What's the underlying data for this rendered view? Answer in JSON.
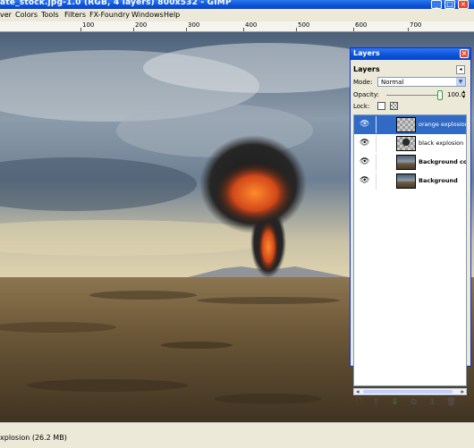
{
  "window": {
    "title": "ate_stock.jpg-1.0 (RGB, 4 layers) 800x532 - GIMP"
  },
  "menu": [
    "ver",
    "Colors",
    "Tools",
    "Filters",
    "FX-Foundry",
    "Windows",
    "Help"
  ],
  "ruler": {
    "labels": [
      "100",
      "200",
      "300",
      "400",
      "500",
      "600",
      "700"
    ]
  },
  "status": {
    "text": "xplosion (26.2 MB)"
  },
  "layers_dialog": {
    "window_title": "Layers",
    "tab_label": "Layers",
    "mode_label": "Mode:",
    "mode_value": "Normal",
    "opacity_label": "Opacity:",
    "opacity_value": "100.0",
    "lock_label": "Lock:",
    "layers": [
      {
        "name": "orange explosion",
        "selected": true,
        "bold": false,
        "thumb": "checker"
      },
      {
        "name": "black explosion",
        "selected": false,
        "bold": false,
        "thumb": "boom"
      },
      {
        "name": "Background copy",
        "selected": false,
        "bold": true,
        "thumb": "photo"
      },
      {
        "name": "Background",
        "selected": false,
        "bold": true,
        "thumb": "photo"
      }
    ],
    "buttons": [
      "new-layer",
      "raise-layer",
      "lower-layer",
      "duplicate-layer",
      "anchor-layer",
      "delete-layer"
    ]
  },
  "colors": {
    "selection": "#316ac5",
    "titlebar": "#0a52d8"
  }
}
